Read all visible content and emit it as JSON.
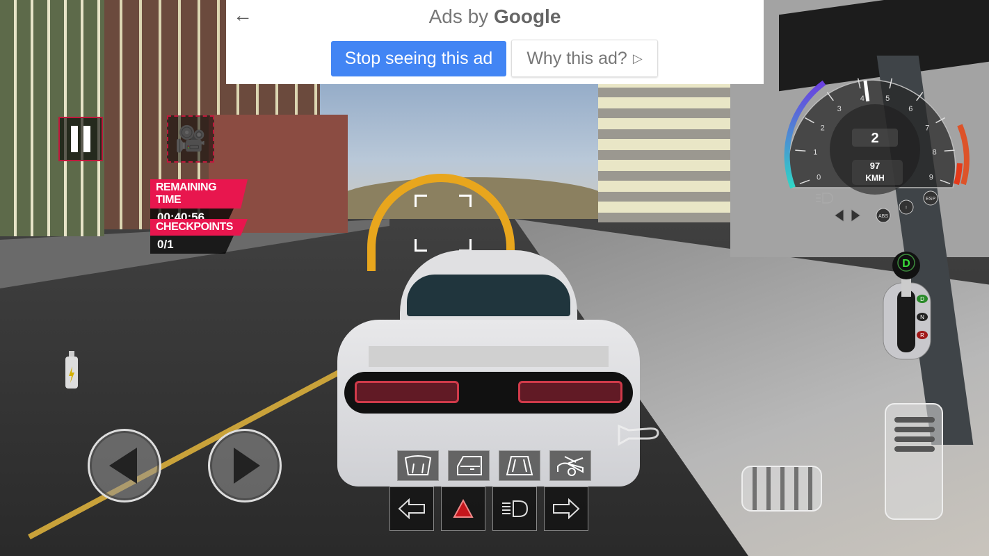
{
  "ad": {
    "back_icon": "arrow-left-icon",
    "ads_by": "Ads by",
    "brand": "Google",
    "stop_label": "Stop seeing this ad",
    "why_label": "Why this ad?",
    "why_icon": "adchoices-play-icon",
    "accent": "#4285f4"
  },
  "hud": {
    "remaining_time_label": "REMAINING TIME",
    "remaining_time": "00:40:56",
    "checkpoints_label": "CHECKPOINTS",
    "checkpoints": "0/1",
    "accent": "#e8164e"
  },
  "gauge": {
    "ticks": [
      "0",
      "1",
      "2",
      "3",
      "4",
      "5",
      "6",
      "7",
      "8",
      "9"
    ],
    "rpm_x1000": 4.2,
    "gear": "2",
    "speed": "97",
    "unit": "KMH",
    "badges": [
      "ABS",
      "!",
      "ESP"
    ]
  },
  "shifter": {
    "current": "D",
    "positions": [
      "D",
      "N",
      "R"
    ]
  },
  "controls": {
    "bottom_top_row": [
      "wiper-icon",
      "door-icon",
      "hood-icon",
      "trunk-icon"
    ],
    "bottom_row": [
      "left-signal-icon",
      "hazard-icon",
      "headlight-icon",
      "right-signal-icon"
    ]
  }
}
